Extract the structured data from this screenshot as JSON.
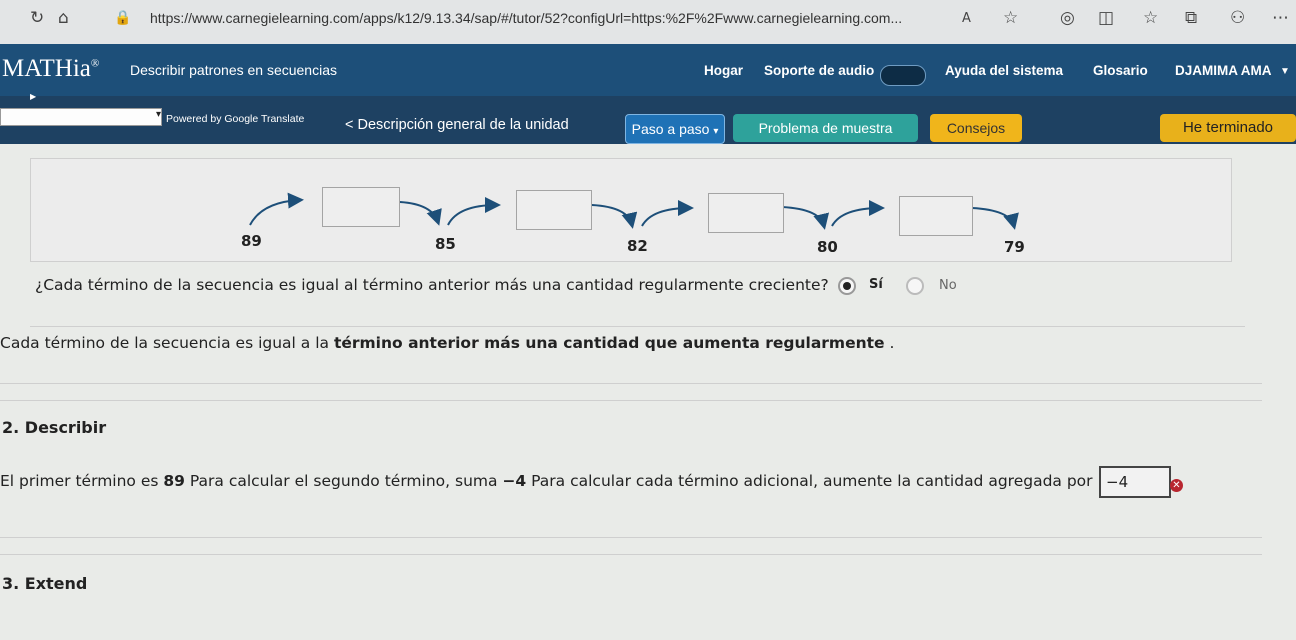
{
  "browser": {
    "url": "https://www.carnegielearning.com/apps/k12/9.13.34/sap/#/tutor/52?configUrl=https:%2F%2Fwww.carnegielearning.com..."
  },
  "nav": {
    "logo": "MATHia",
    "logo_mark": "®",
    "subtitle": "Describir patrones en secuencias",
    "home": "Hogar",
    "audio": "Soporte de audio",
    "help": "Ayuda del sistema",
    "glossary": "Glosario",
    "user": "DJAMIMA AMA"
  },
  "toolbar": {
    "powered": "Powered by Google Translate",
    "overview": "< Descripción general de la unidad",
    "step_by_step": "Paso a paso",
    "sample_problem": "Problema de muestra",
    "hints": "Consejos",
    "done": "He terminado"
  },
  "sequence": {
    "terms": [
      "89",
      "85",
      "82",
      "80",
      "79"
    ]
  },
  "question": {
    "text": "¿Cada término de la secuencia es igual al término anterior más una cantidad regularmente creciente?",
    "yes": "Sí",
    "no": "No",
    "selected": "yes"
  },
  "conclusion": {
    "text_start": "Cada término de la secuencia es igual a la ",
    "text_bold": "término anterior más una cantidad que aumenta regularmente",
    "text_end": " ."
  },
  "section2": {
    "heading": "2. Describir",
    "part1": "El primer término es ",
    "first_term": "89",
    "part2": " Para calcular el segundo término, suma ",
    "second_add": "−4",
    "part3": " Para calcular cada término adicional, aumente la cantidad agregada por",
    "answer_value": "−4"
  },
  "section3": {
    "heading": "3. Extend"
  },
  "colors": {
    "nav": "#1d4f79",
    "toolbar": "#1e4162",
    "step_button": "#1f72b6",
    "sample_button": "#2ea29b",
    "hints_button": "#f0b51b",
    "done_button": "#e8b11b",
    "error": "#b8262f"
  }
}
